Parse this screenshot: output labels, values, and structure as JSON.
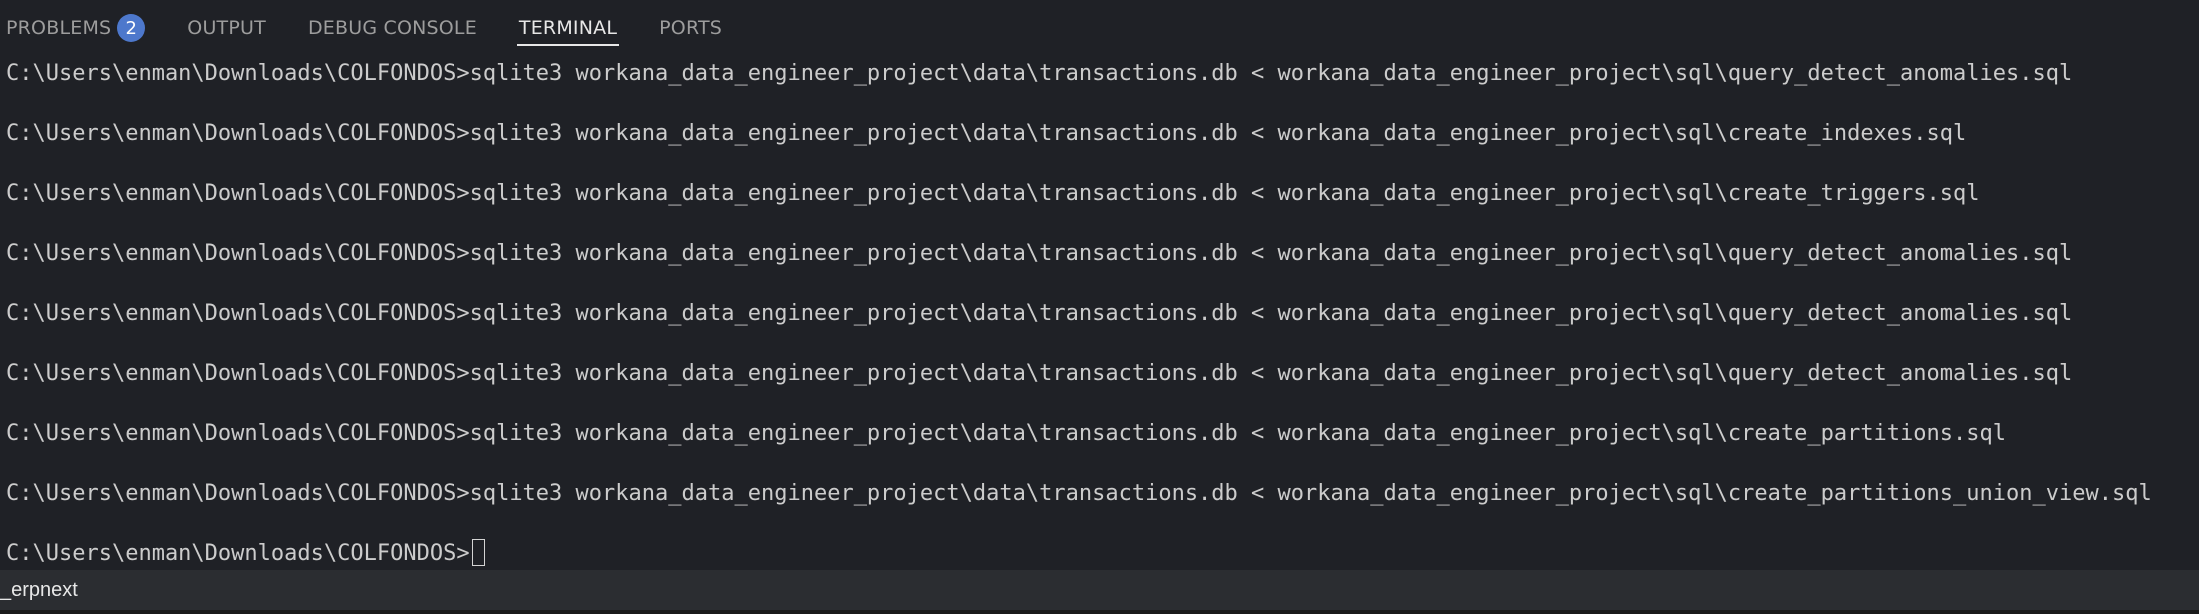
{
  "tabs": [
    {
      "label": "PROBLEMS",
      "badge": "2",
      "active": false
    },
    {
      "label": "OUTPUT",
      "active": false
    },
    {
      "label": "DEBUG CONSOLE",
      "active": false
    },
    {
      "label": "TERMINAL",
      "active": true
    },
    {
      "label": "PORTS",
      "active": false
    }
  ],
  "terminal": {
    "lines": [
      "C:\\Users\\enman\\Downloads\\COLFONDOS>sqlite3 workana_data_engineer_project\\data\\transactions.db < workana_data_engineer_project\\sql\\query_detect_anomalies.sql",
      "C:\\Users\\enman\\Downloads\\COLFONDOS>sqlite3 workana_data_engineer_project\\data\\transactions.db < workana_data_engineer_project\\sql\\create_indexes.sql",
      "C:\\Users\\enman\\Downloads\\COLFONDOS>sqlite3 workana_data_engineer_project\\data\\transactions.db < workana_data_engineer_project\\sql\\create_triggers.sql",
      "C:\\Users\\enman\\Downloads\\COLFONDOS>sqlite3 workana_data_engineer_project\\data\\transactions.db < workana_data_engineer_project\\sql\\query_detect_anomalies.sql",
      "C:\\Users\\enman\\Downloads\\COLFONDOS>sqlite3 workana_data_engineer_project\\data\\transactions.db < workana_data_engineer_project\\sql\\query_detect_anomalies.sql",
      "C:\\Users\\enman\\Downloads\\COLFONDOS>sqlite3 workana_data_engineer_project\\data\\transactions.db < workana_data_engineer_project\\sql\\query_detect_anomalies.sql",
      "C:\\Users\\enman\\Downloads\\COLFONDOS>sqlite3 workana_data_engineer_project\\data\\transactions.db < workana_data_engineer_project\\sql\\create_partitions.sql",
      "C:\\Users\\enman\\Downloads\\COLFONDOS>sqlite3 workana_data_engineer_project\\data\\transactions.db < workana_data_engineer_project\\sql\\create_partitions_union_view.sql"
    ],
    "prompt": "C:\\Users\\enman\\Downloads\\COLFONDOS>"
  },
  "statusbar": {
    "text": "_erpnext"
  },
  "colors": {
    "background": "#1f2126",
    "badge": "#4d78cc",
    "text": "#cccccc"
  }
}
